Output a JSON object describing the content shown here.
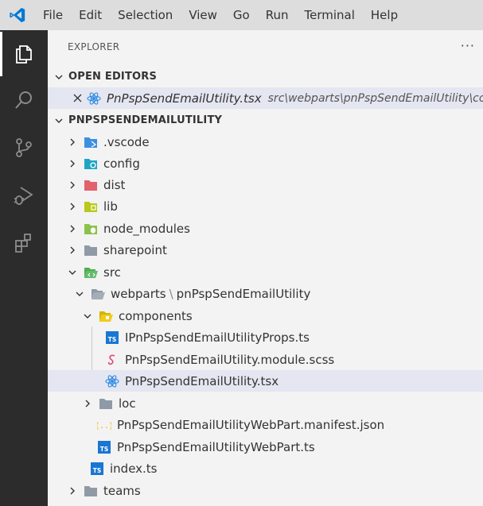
{
  "menu": [
    "File",
    "Edit",
    "Selection",
    "View",
    "Go",
    "Run",
    "Terminal",
    "Help"
  ],
  "activity": [
    "explorer-icon",
    "search-icon",
    "source-control-icon",
    "run-debug-icon",
    "extensions-icon"
  ],
  "explorer": {
    "title": "EXPLORER",
    "more": "···",
    "open_editors": {
      "header": "OPEN EDITORS",
      "file": "PnPspSendEmailUtility.tsx",
      "path": "src\\webparts\\pnPspSendEmailUtility\\compo..."
    },
    "project": {
      "header": "PNPSPSENDEMAILUTILITY",
      "folders": [
        ".vscode",
        "config",
        "dist",
        "lib",
        "node_modules",
        "sharepoint"
      ],
      "src": "src",
      "webparts": "webparts",
      "sep": "\\",
      "webpart_folder": "pnPspSendEmailUtility",
      "components": "components",
      "files": {
        "props": "IPnPspSendEmailUtilityProps.ts",
        "scss": "PnPspSendEmailUtility.module.scss",
        "tsx": "PnPspSendEmailUtility.tsx",
        "loc": "loc",
        "manifest": "PnPspSendEmailUtilityWebPart.manifest.json",
        "webpart_ts": "PnPspSendEmailUtilityWebPart.ts",
        "index": "index.ts",
        "teams": "teams"
      }
    }
  },
  "colors": {
    "accent": "#007acc",
    "activity_bar": "#2c2c2c",
    "title_bar": "#dddddd",
    "selected_row": "#e4e6f1"
  }
}
